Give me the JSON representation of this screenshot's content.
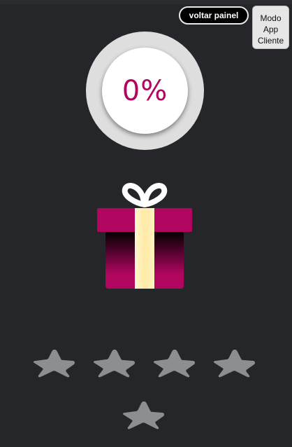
{
  "header": {
    "voltar_label": "voltar painel",
    "modo_lines": [
      "Modo",
      "App",
      "Cliente"
    ]
  },
  "progress": {
    "text": "0%",
    "value": 0
  },
  "gift": {
    "icon": "gift-icon"
  },
  "rating": {
    "total": 5,
    "filled": 0,
    "icon": "star-icon"
  },
  "colors": {
    "background": "#252629",
    "accent": "#b0065f",
    "ribbon": "#fff2b8",
    "star_empty": "#8c8e92",
    "ring": "#dedede"
  }
}
